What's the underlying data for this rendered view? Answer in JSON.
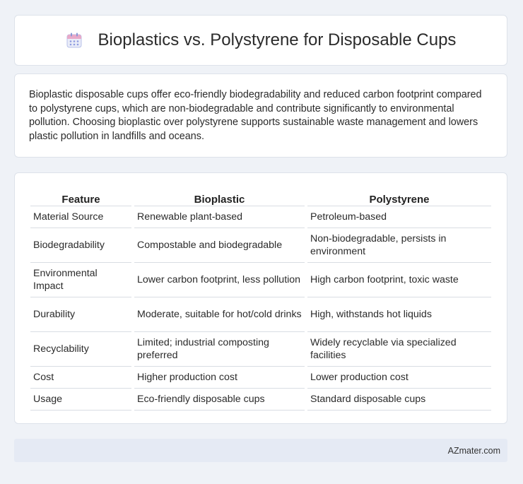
{
  "header": {
    "title": "Bioplastics vs. Polystyrene for Disposable Cups",
    "icon": "calendar-icon"
  },
  "intro": {
    "text": "Bioplastic disposable cups offer eco-friendly biodegradability and reduced carbon footprint compared to polystyrene cups, which are non-biodegradable and contribute significantly to environmental pollution. Choosing bioplastic over polystyrene supports sustainable waste management and lowers plastic pollution in landfills and oceans."
  },
  "table": {
    "headers": [
      "Feature",
      "Bioplastic",
      "Polystyrene"
    ],
    "rows": [
      [
        "Material Source",
        "Renewable plant-based",
        "Petroleum-based"
      ],
      [
        "Biodegradability",
        "Compostable and biodegradable",
        "Non-biodegradable, persists in environment"
      ],
      [
        "Environmental Impact",
        "Lower carbon footprint, less pollution",
        "High carbon footprint, toxic waste"
      ],
      [
        "Durability",
        "Moderate, suitable for hot/cold drinks",
        "High, withstands hot liquids"
      ],
      [
        "Recyclability",
        "Limited; industrial composting preferred",
        "Widely recyclable via specialized facilities"
      ],
      [
        "Cost",
        "Higher production cost",
        "Lower production cost"
      ],
      [
        "Usage",
        "Eco-friendly disposable cups",
        "Standard disposable cups"
      ]
    ]
  },
  "footer": {
    "text": "AZmater.com"
  },
  "colors": {
    "background": "#eff2f7",
    "card": "#ffffff",
    "footer": "#e5eaf4",
    "icon_accent": "#7b8fd8"
  }
}
